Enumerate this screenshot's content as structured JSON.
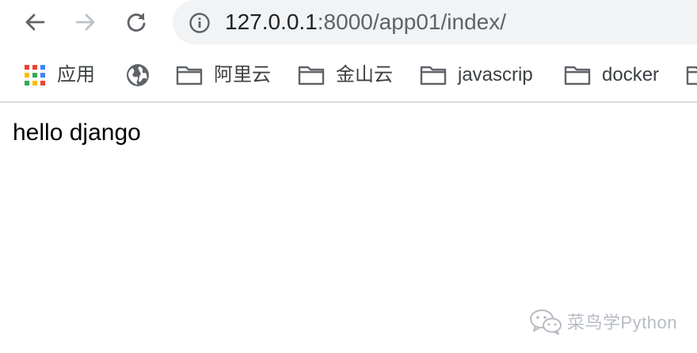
{
  "browser": {
    "url_host": "127.0.0.1",
    "url_rest": ":8000/app01/index/",
    "back_enabled": true,
    "forward_enabled": false
  },
  "bookmarks": [
    {
      "label": "应用",
      "icon": "apps-grid-icon"
    },
    {
      "label": "",
      "icon": "globe-icon"
    },
    {
      "label": "阿里云",
      "icon": "folder-icon"
    },
    {
      "label": "金山云",
      "icon": "folder-icon"
    },
    {
      "label": "javascrip",
      "icon": "folder-icon"
    },
    {
      "label": "docker",
      "icon": "folder-icon"
    }
  ],
  "content": {
    "text": "hello django"
  },
  "watermark": {
    "text": "菜鸟学Python"
  },
  "colors": {
    "omnibox_bg": "#f1f3f4",
    "icon_gray": "#5f6368",
    "icon_disabled": "#bdc1c6",
    "apps_red": "#ea4335",
    "apps_yellow": "#fbbc05",
    "apps_green": "#34a853",
    "apps_blue": "#4285f4"
  }
}
